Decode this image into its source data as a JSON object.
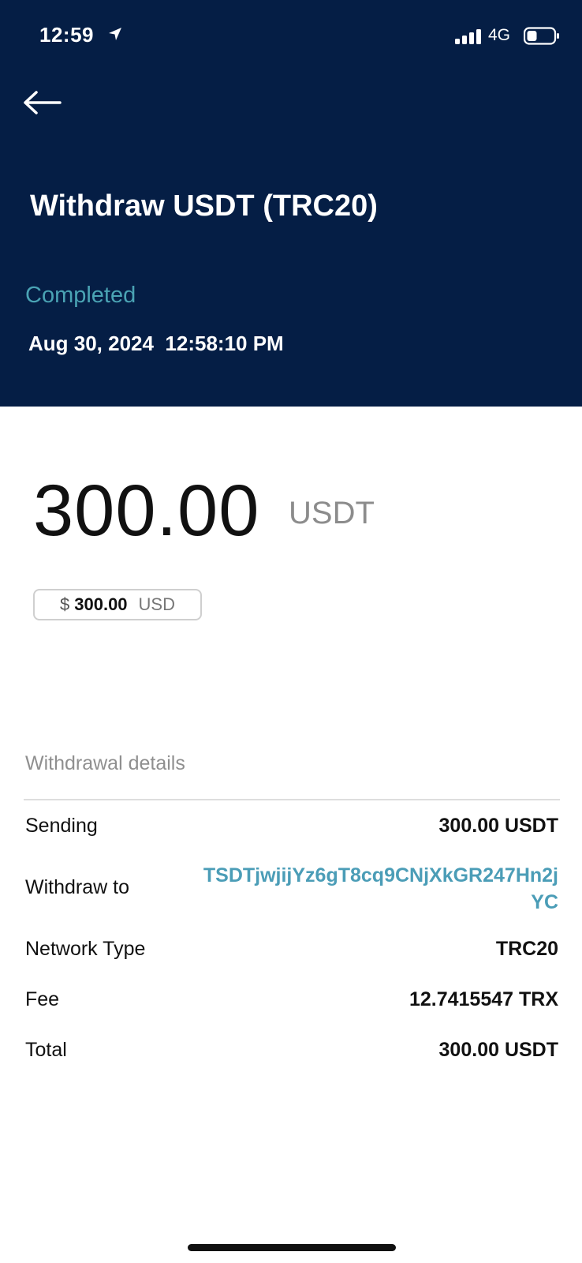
{
  "status_bar": {
    "time": "12:59",
    "network": "4G"
  },
  "header": {
    "title": "Withdraw USDT (TRC20)",
    "status": "Completed",
    "timestamp": "Aug 30, 2024  12:58:10 PM"
  },
  "amount": {
    "value": "300.00",
    "currency": "USDT",
    "usd_sign": "$",
    "usd_value": "300.00",
    "usd_unit": "USD"
  },
  "details": {
    "section_title": "Withdrawal details",
    "rows": [
      {
        "label": "Sending",
        "value": "300.00 USDT"
      },
      {
        "label": "Withdraw to",
        "value": "TSDTjwjijYz6gT8cq9CNjXkGR247Hn2jYC"
      },
      {
        "label": "Network Type",
        "value": "TRC20"
      },
      {
        "label": "Fee",
        "value": "12.7415547 TRX"
      },
      {
        "label": "Total",
        "value": "300.00 USDT"
      }
    ]
  },
  "colors": {
    "header_bg": "#051e45",
    "status_accent": "#4aa3b4",
    "link": "#4b9db7"
  }
}
